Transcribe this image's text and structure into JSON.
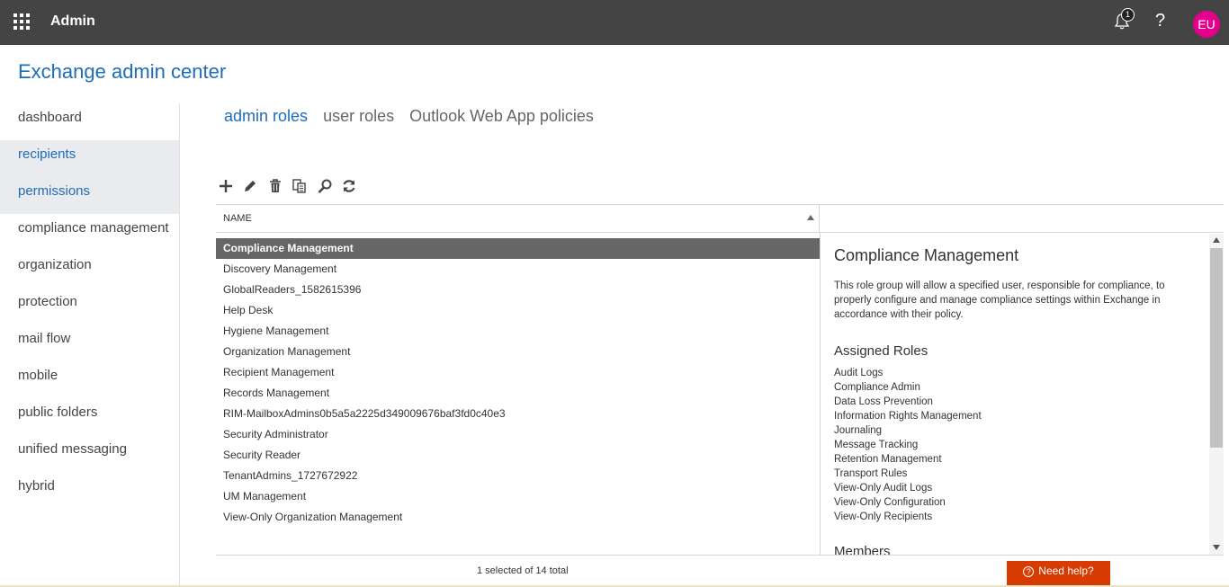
{
  "topbar": {
    "app_title": "Admin",
    "notification_count": "1",
    "help_glyph": "?",
    "avatar_initials": "EU",
    "avatar_color": "#e3008c"
  },
  "page_title": "Exchange admin center",
  "accent_color": "#1f6cb8",
  "leftnav": {
    "items": [
      {
        "label": "dashboard"
      },
      {
        "label": "recipients"
      },
      {
        "label": "permissions"
      },
      {
        "label": "compliance management"
      },
      {
        "label": "organization"
      },
      {
        "label": "protection"
      },
      {
        "label": "mail flow"
      },
      {
        "label": "mobile"
      },
      {
        "label": "public folders"
      },
      {
        "label": "unified messaging"
      },
      {
        "label": "hybrid"
      }
    ],
    "selected": "permissions"
  },
  "tabs": [
    {
      "label": "admin roles",
      "active": true
    },
    {
      "label": "user roles",
      "active": false
    },
    {
      "label": "Outlook Web App policies",
      "active": false
    }
  ],
  "toolbar": {
    "icons": [
      "add-icon",
      "edit-icon",
      "delete-icon",
      "copy-icon",
      "search-icon",
      "refresh-icon"
    ]
  },
  "list": {
    "column_header": "NAME",
    "rows": [
      "Compliance Management",
      "Discovery Management",
      "GlobalReaders_1582615396",
      "Help Desk",
      "Hygiene Management",
      "Organization Management",
      "Recipient Management",
      "Records Management",
      "RIM-MailboxAdmins0b5a5a2225d349009676baf3fd0c40e3",
      "Security Administrator",
      "Security Reader",
      "TenantAdmins_1727672922",
      "UM Management",
      "View-Only Organization Management"
    ],
    "selected_row": "Compliance Management",
    "status": "1 selected of 14 total"
  },
  "details": {
    "title": "Compliance Management",
    "description": "This role group will allow a specified user, responsible for compliance, to properly configure and manage compliance settings within Exchange in accordance with their policy.",
    "assigned_roles_heading": "Assigned Roles",
    "assigned_roles": [
      "Audit Logs",
      "Compliance Admin",
      "Data Loss Prevention",
      "Information Rights Management",
      "Journaling",
      "Message Tracking",
      "Retention Management",
      "Transport Rules",
      "View-Only Audit Logs",
      "View-Only Configuration",
      "View-Only Recipients"
    ],
    "members_heading": "Members"
  },
  "need_help": {
    "label": "Need help?",
    "color": "#d83b01"
  }
}
